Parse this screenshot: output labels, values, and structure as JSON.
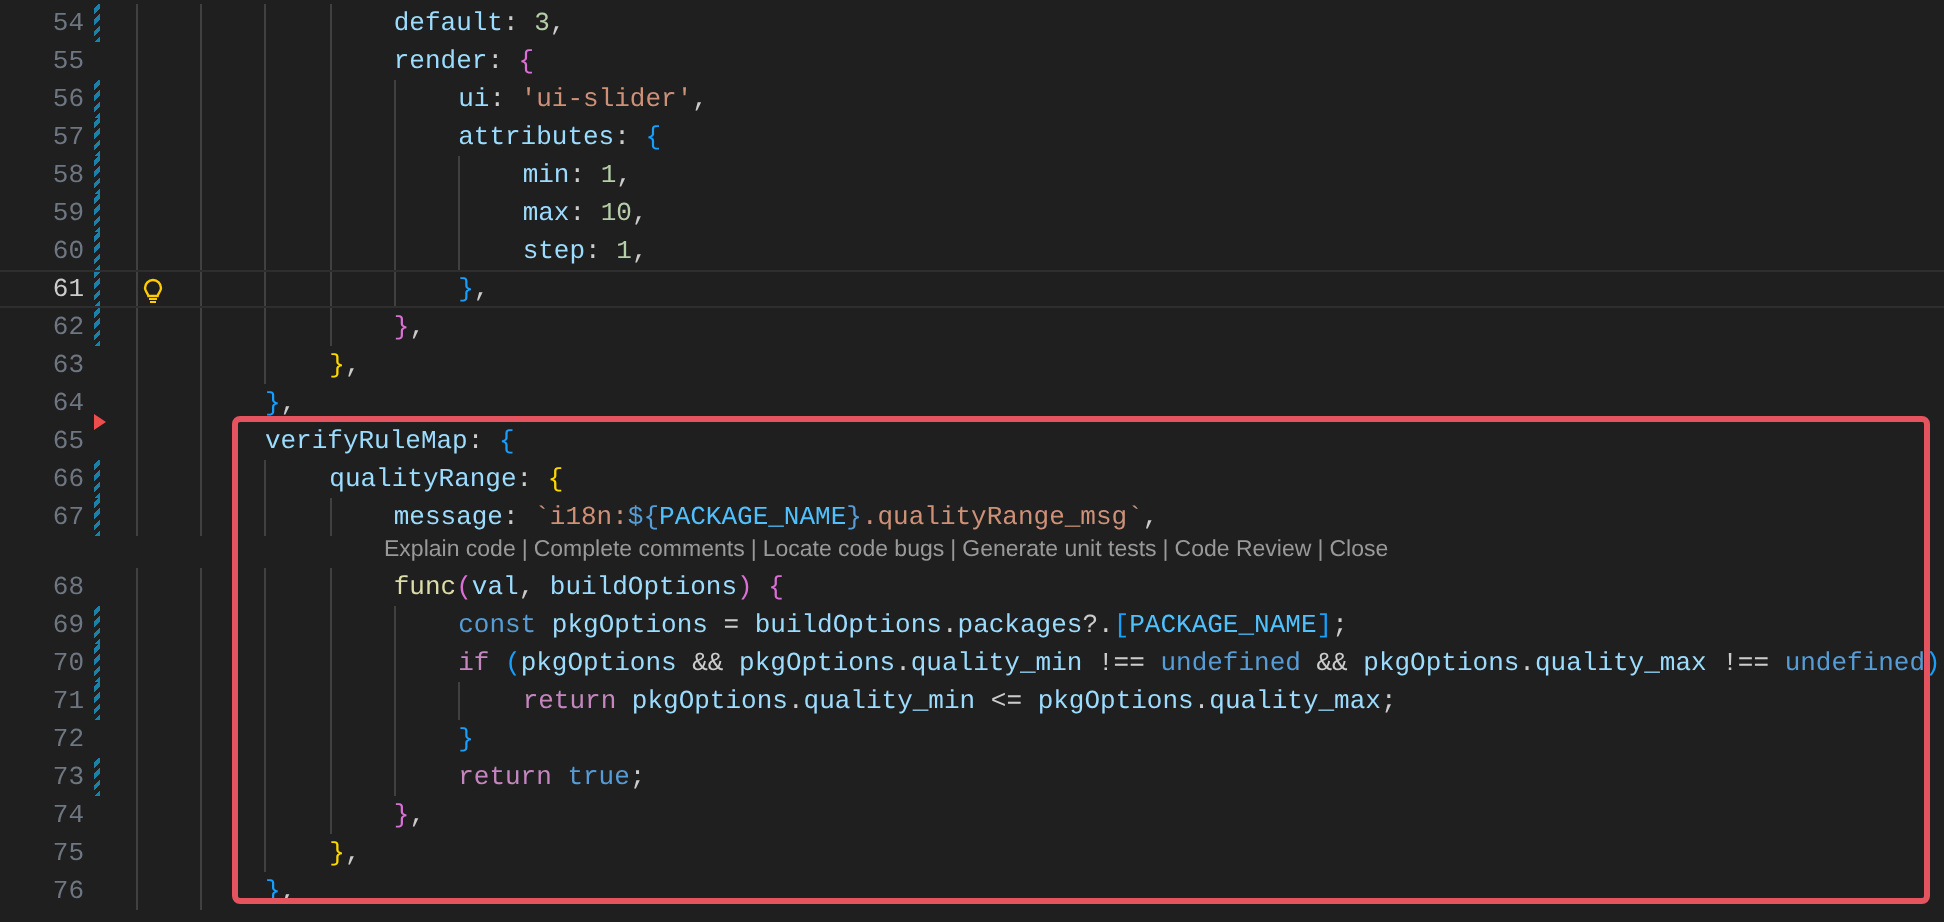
{
  "editor": {
    "lines": [
      {
        "kind": "code",
        "number": "54",
        "modified": true,
        "current": false,
        "lightbulb": false,
        "tokens": [
          {
            "kind": "prop",
            "text": "                default"
          },
          {
            "kind": "punct",
            "text": ": "
          },
          {
            "kind": "num",
            "text": "3"
          },
          {
            "kind": "punct",
            "text": ","
          }
        ]
      },
      {
        "kind": "code",
        "number": "55",
        "modified": false,
        "current": false,
        "lightbulb": false,
        "tokens": [
          {
            "kind": "prop",
            "text": "                render"
          },
          {
            "kind": "punct",
            "text": ": "
          },
          {
            "kind": "b2",
            "text": "{"
          }
        ]
      },
      {
        "kind": "code",
        "number": "56",
        "modified": true,
        "current": false,
        "lightbulb": false,
        "tokens": [
          {
            "kind": "prop",
            "text": "                    ui"
          },
          {
            "kind": "punct",
            "text": ": "
          },
          {
            "kind": "str",
            "text": "'ui-slider'"
          },
          {
            "kind": "punct",
            "text": ","
          }
        ]
      },
      {
        "kind": "code",
        "number": "57",
        "modified": true,
        "current": false,
        "lightbulb": false,
        "tokens": [
          {
            "kind": "prop",
            "text": "                    attributes"
          },
          {
            "kind": "punct",
            "text": ": "
          },
          {
            "kind": "b3",
            "text": "{"
          }
        ]
      },
      {
        "kind": "code",
        "number": "58",
        "modified": true,
        "current": false,
        "lightbulb": false,
        "tokens": [
          {
            "kind": "prop",
            "text": "                        min"
          },
          {
            "kind": "punct",
            "text": ": "
          },
          {
            "kind": "num",
            "text": "1"
          },
          {
            "kind": "punct",
            "text": ","
          }
        ]
      },
      {
        "kind": "code",
        "number": "59",
        "modified": true,
        "current": false,
        "lightbulb": false,
        "tokens": [
          {
            "kind": "prop",
            "text": "                        max"
          },
          {
            "kind": "punct",
            "text": ": "
          },
          {
            "kind": "num",
            "text": "10"
          },
          {
            "kind": "punct",
            "text": ","
          }
        ]
      },
      {
        "kind": "code",
        "number": "60",
        "modified": true,
        "current": false,
        "lightbulb": false,
        "tokens": [
          {
            "kind": "prop",
            "text": "                        step"
          },
          {
            "kind": "punct",
            "text": ": "
          },
          {
            "kind": "num",
            "text": "1"
          },
          {
            "kind": "punct",
            "text": ","
          }
        ]
      },
      {
        "kind": "code",
        "number": "61",
        "modified": true,
        "current": true,
        "lightbulb": true,
        "tokens": [
          {
            "kind": "b3",
            "text": "                    }"
          },
          {
            "kind": "punct",
            "text": ","
          }
        ]
      },
      {
        "kind": "code",
        "number": "62",
        "modified": true,
        "current": false,
        "lightbulb": false,
        "tokens": [
          {
            "kind": "b2",
            "text": "                }"
          },
          {
            "kind": "punct",
            "text": ","
          }
        ]
      },
      {
        "kind": "code",
        "number": "63",
        "modified": false,
        "current": false,
        "lightbulb": false,
        "tokens": [
          {
            "kind": "b1",
            "text": "            }"
          },
          {
            "kind": "punct",
            "text": ","
          }
        ]
      },
      {
        "kind": "code",
        "number": "64",
        "modified": false,
        "current": false,
        "lightbulb": false,
        "tokens": [
          {
            "kind": "b3",
            "text": "        }"
          },
          {
            "kind": "punct",
            "text": ","
          }
        ]
      }
    ],
    "framed_lines": [
      {
        "kind": "code",
        "number": "65",
        "modified": false,
        "current": false,
        "lightbulb": false,
        "deleted_marker": true,
        "tokens": [
          {
            "kind": "prop",
            "text": "        verifyRuleMap"
          },
          {
            "kind": "punct",
            "text": ": "
          },
          {
            "kind": "b3",
            "text": "{"
          }
        ]
      },
      {
        "kind": "code",
        "number": "66",
        "modified": true,
        "current": false,
        "lightbulb": false,
        "tokens": [
          {
            "kind": "prop",
            "text": "            qualityRange"
          },
          {
            "kind": "punct",
            "text": ": "
          },
          {
            "kind": "b1",
            "text": "{"
          }
        ]
      },
      {
        "kind": "code",
        "number": "67",
        "modified": true,
        "current": false,
        "lightbulb": false,
        "tokens": [
          {
            "kind": "prop",
            "text": "                message"
          },
          {
            "kind": "punct",
            "text": ": "
          },
          {
            "kind": "str",
            "text": "`i18n:"
          },
          {
            "kind": "kw",
            "text": "${"
          },
          {
            "kind": "const",
            "text": "PACKAGE_NAME"
          },
          {
            "kind": "kw",
            "text": "}"
          },
          {
            "kind": "str",
            "text": ".qualityRange_msg`"
          },
          {
            "kind": "punct",
            "text": ","
          }
        ]
      },
      {
        "kind": "codelens",
        "separator": "|",
        "actions": [
          "Explain code",
          "Complete comments",
          "Locate code bugs",
          "Generate unit tests",
          "Code Review",
          "Close"
        ]
      },
      {
        "kind": "code",
        "number": "68",
        "modified": false,
        "current": false,
        "lightbulb": false,
        "tokens": [
          {
            "kind": "fn",
            "text": "                func"
          },
          {
            "kind": "b2",
            "text": "("
          },
          {
            "kind": "prop",
            "text": "val"
          },
          {
            "kind": "punct",
            "text": ", "
          },
          {
            "kind": "prop",
            "text": "buildOptions"
          },
          {
            "kind": "b2",
            "text": ")"
          },
          {
            "kind": "b2",
            "text": " {"
          }
        ]
      },
      {
        "kind": "code",
        "number": "69",
        "modified": true,
        "current": false,
        "lightbulb": false,
        "tokens": [
          {
            "kind": "kw",
            "text": "                    const"
          },
          {
            "kind": "prop",
            "text": " pkgOptions"
          },
          {
            "kind": "punct",
            "text": " = "
          },
          {
            "kind": "prop",
            "text": "buildOptions"
          },
          {
            "kind": "punct",
            "text": "."
          },
          {
            "kind": "prop",
            "text": "packages"
          },
          {
            "kind": "punct",
            "text": "?."
          },
          {
            "kind": "b3",
            "text": "["
          },
          {
            "kind": "const",
            "text": "PACKAGE_NAME"
          },
          {
            "kind": "b3",
            "text": "]"
          },
          {
            "kind": "punct",
            "text": ";"
          }
        ]
      },
      {
        "kind": "code",
        "number": "70",
        "modified": true,
        "current": false,
        "lightbulb": false,
        "tokens": [
          {
            "kind": "ctl",
            "text": "                    if"
          },
          {
            "kind": "b3",
            "text": " ("
          },
          {
            "kind": "prop",
            "text": "pkgOptions"
          },
          {
            "kind": "punct",
            "text": " && "
          },
          {
            "kind": "prop",
            "text": "pkgOptions"
          },
          {
            "kind": "punct",
            "text": "."
          },
          {
            "kind": "prop",
            "text": "quality_min"
          },
          {
            "kind": "punct",
            "text": " !== "
          },
          {
            "kind": "kw",
            "text": "undefined"
          },
          {
            "kind": "punct",
            "text": " && "
          },
          {
            "kind": "prop",
            "text": "pkgOptions"
          },
          {
            "kind": "punct",
            "text": "."
          },
          {
            "kind": "prop",
            "text": "quality_max"
          },
          {
            "kind": "punct",
            "text": " !== "
          },
          {
            "kind": "kw",
            "text": "undefined"
          },
          {
            "kind": "b3",
            "text": ")"
          }
        ]
      },
      {
        "kind": "code",
        "number": "71",
        "modified": true,
        "current": false,
        "lightbulb": false,
        "tokens": [
          {
            "kind": "ctl",
            "text": "                        return"
          },
          {
            "kind": "prop",
            "text": " pkgOptions"
          },
          {
            "kind": "punct",
            "text": "."
          },
          {
            "kind": "prop",
            "text": "quality_min"
          },
          {
            "kind": "punct",
            "text": " <= "
          },
          {
            "kind": "prop",
            "text": "pkgOptions"
          },
          {
            "kind": "punct",
            "text": "."
          },
          {
            "kind": "prop",
            "text": "quality_max"
          },
          {
            "kind": "punct",
            "text": ";"
          }
        ]
      },
      {
        "kind": "code",
        "number": "72",
        "modified": false,
        "current": false,
        "lightbulb": false,
        "tokens": [
          {
            "kind": "b3",
            "text": "                    }"
          }
        ]
      },
      {
        "kind": "code",
        "number": "73",
        "modified": true,
        "current": false,
        "lightbulb": false,
        "tokens": [
          {
            "kind": "ctl",
            "text": "                    return"
          },
          {
            "kind": "kw",
            "text": " true"
          },
          {
            "kind": "punct",
            "text": ";"
          }
        ]
      },
      {
        "kind": "code",
        "number": "74",
        "modified": false,
        "current": false,
        "lightbulb": false,
        "tokens": [
          {
            "kind": "b2",
            "text": "                }"
          },
          {
            "kind": "punct",
            "text": ","
          }
        ]
      },
      {
        "kind": "code",
        "number": "75",
        "modified": false,
        "current": false,
        "lightbulb": false,
        "tokens": [
          {
            "kind": "b1",
            "text": "            }"
          },
          {
            "kind": "punct",
            "text": ","
          }
        ]
      },
      {
        "kind": "code",
        "number": "76",
        "modified": false,
        "current": false,
        "lightbulb": false,
        "tokens": [
          {
            "kind": "b3",
            "text": "        }"
          },
          {
            "kind": "punct",
            "text": ","
          }
        ]
      }
    ]
  }
}
